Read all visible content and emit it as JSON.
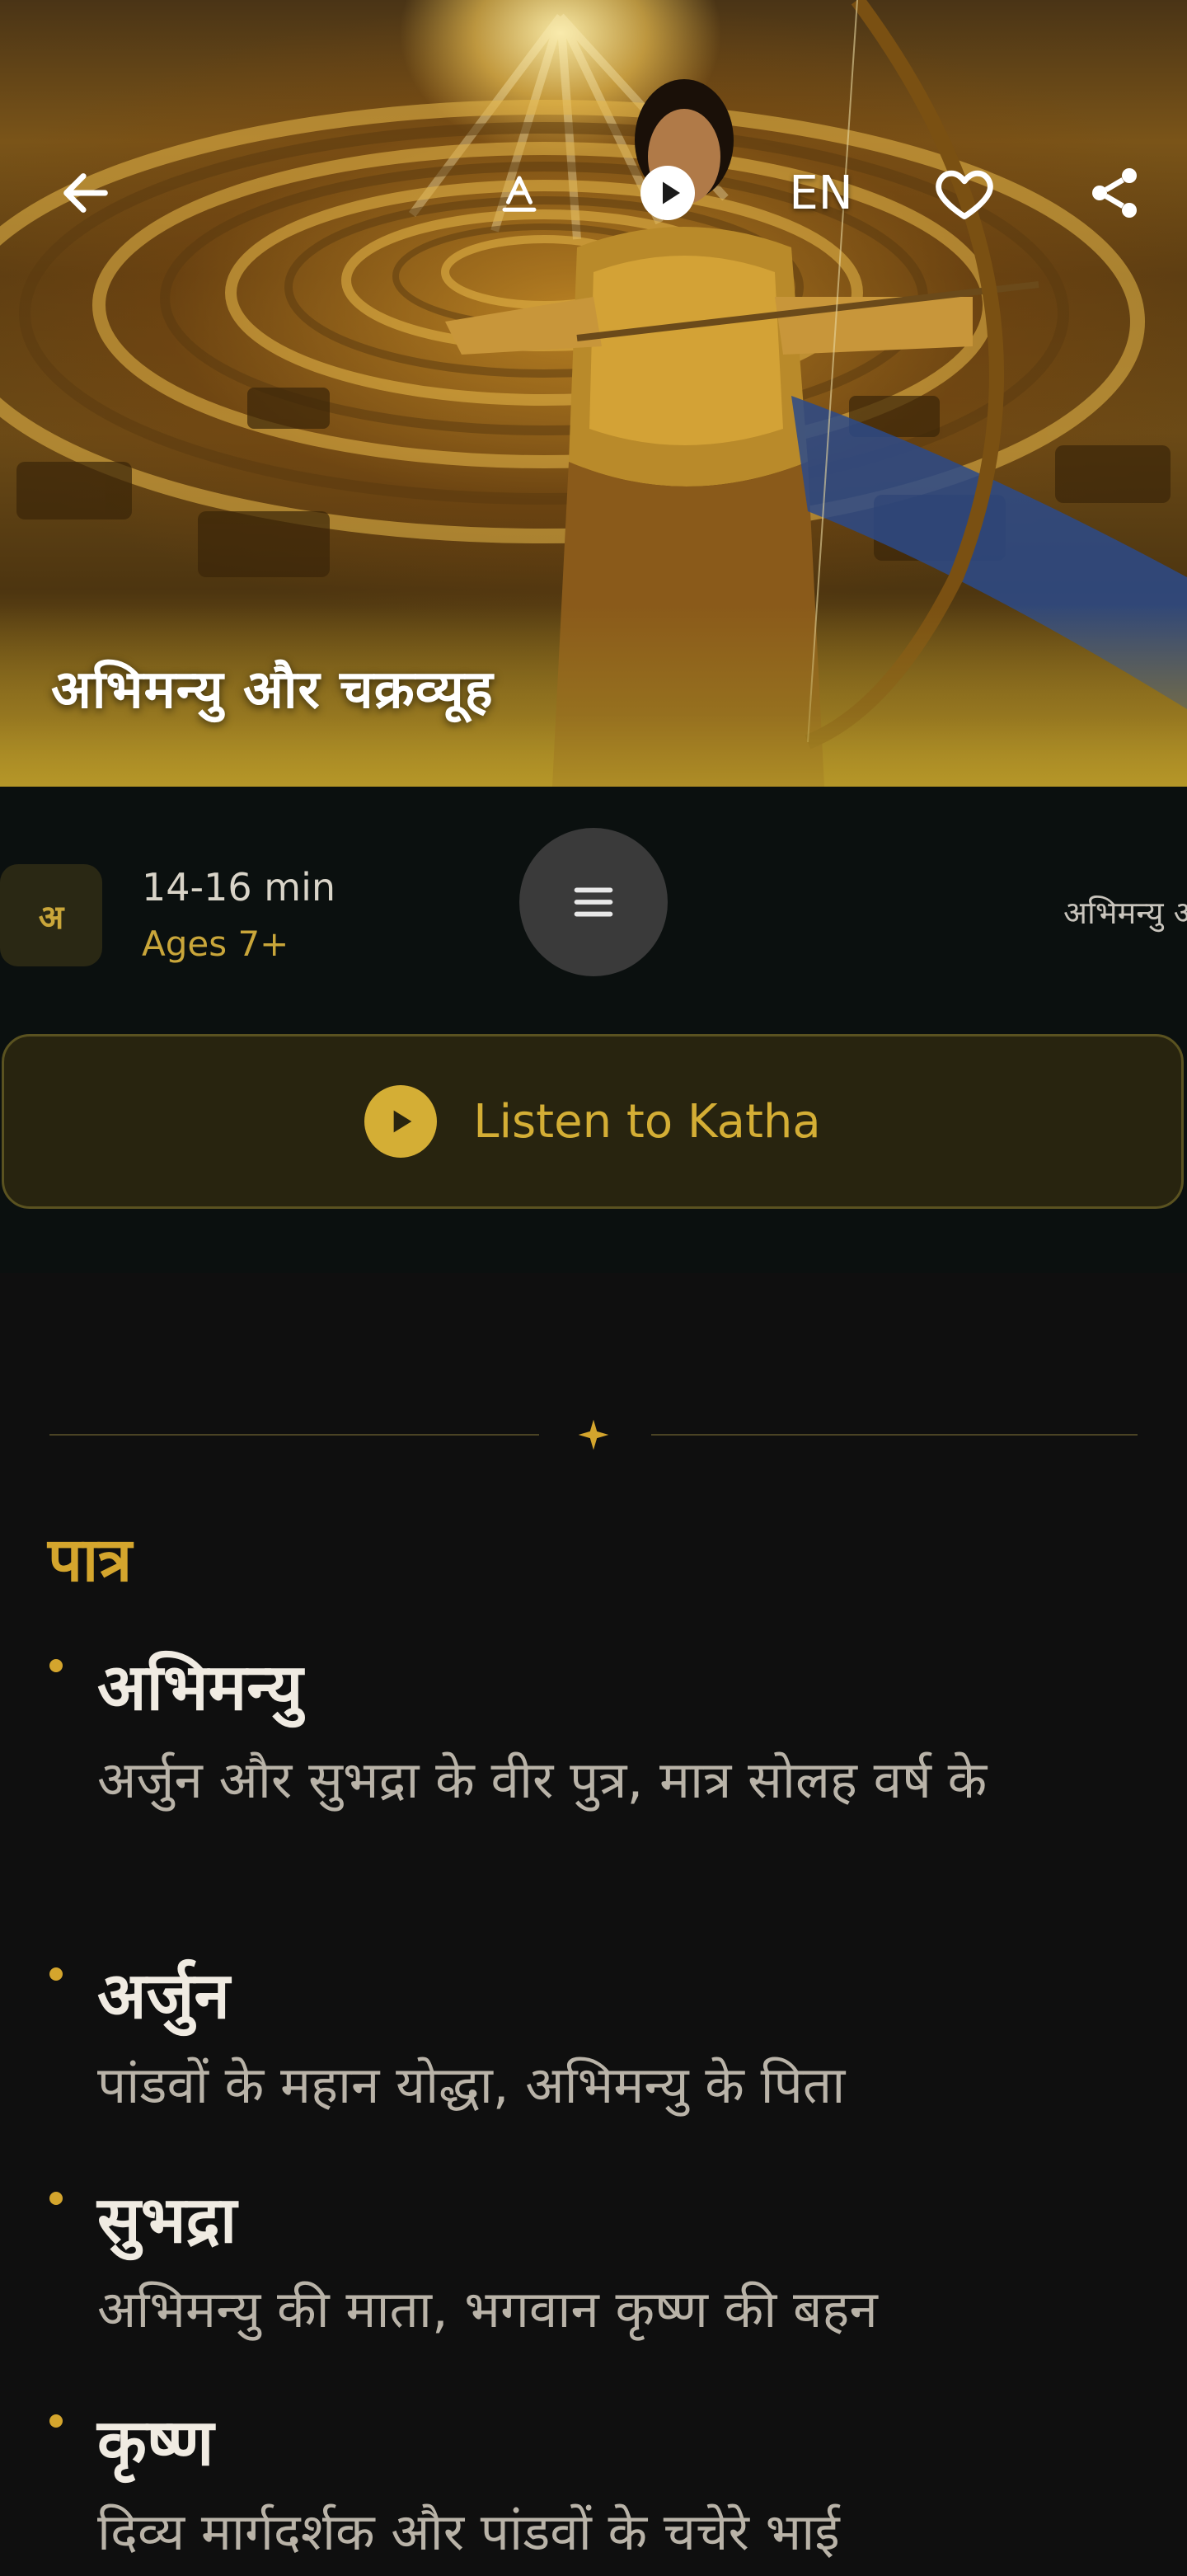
{
  "hero": {
    "title": "अभिमन्यु और चक्रव्यूह",
    "lang_toggle": "EN"
  },
  "info": {
    "lang_badge": "अ",
    "duration": "14-16 min",
    "ages": "Ages 7+",
    "marquee_text": "अभिमन्यु और चक्रव्यूह"
  },
  "listen_button": {
    "label": "Listen to Katha"
  },
  "characters": {
    "section_title": "पात्र",
    "items": [
      {
        "name": "अभिमन्यु",
        "desc": "अर्जुन और सुभद्रा के वीर पुत्र, मात्र सोलह वर्ष के"
      },
      {
        "name": "अर्जुन",
        "desc": "पांडवों के महान योद्धा, अभिमन्यु के पिता"
      },
      {
        "name": "सुभद्रा",
        "desc": "अभिमन्यु की माता, भगवान कृष्ण की बहन"
      },
      {
        "name": "कृष्ण",
        "desc": "दिव्य मार्गदर्शक और पांडवों के चचेरे भाई"
      }
    ]
  },
  "colors": {
    "accent_gold": "#d4a52d",
    "button_bg": "#28240f",
    "info_bg": "#0b100f",
    "page_bg": "#0f0f0f"
  },
  "icons": [
    "back-arrow-icon",
    "text-size-icon",
    "play-icon",
    "heart-icon",
    "share-icon",
    "menu-icon",
    "star-icon"
  ]
}
